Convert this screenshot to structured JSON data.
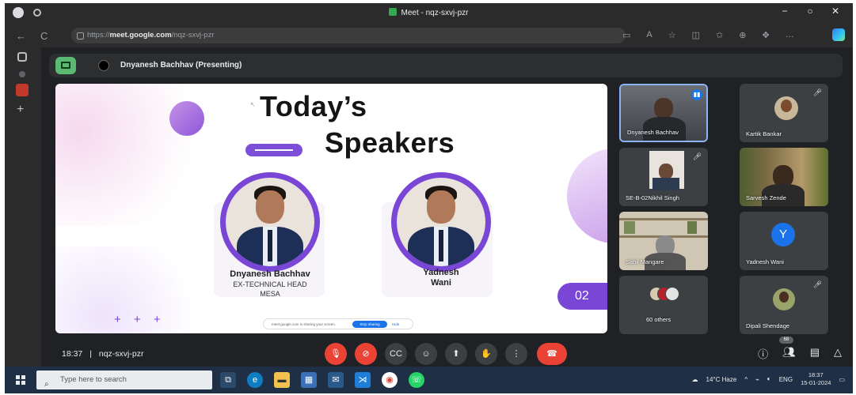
{
  "browser": {
    "tab_title": "Meet - nqz-sxvj-pzr",
    "url_prefix": "https://",
    "url_host": "meet.google.com",
    "url_path": "/nqz-sxvj-pzr",
    "back_icon": "←",
    "reload_icon": "C",
    "minimize": "−",
    "maximize": "○",
    "close": "✕"
  },
  "presenting": {
    "label": "Dnyanesh Bachhav (Presenting)"
  },
  "slide": {
    "title_line1": "Today’s",
    "title_line2": "Speakers",
    "speakers": [
      {
        "name": "Dnyanesh Bachhav",
        "role_line1": "EX-TECHNICAL HEAD",
        "role_line2": "MESA"
      },
      {
        "name_line1": "Yadnesh",
        "name_line2": "Wani"
      }
    ],
    "page_number": "02",
    "stars": "+ + +",
    "share_notice": "meet.google.com is sharing your screen.",
    "stop_sharing": "Stop sharing",
    "hide": "Hide"
  },
  "participants": [
    {
      "name": "Dnyanesh Bachhav",
      "speaking": true
    },
    {
      "name": "Kartik Bankar",
      "muted": true
    },
    {
      "name": "SE-B-02Nikhil Singh",
      "muted": true
    },
    {
      "name": "Sarvesh Zende"
    },
    {
      "name": "Sahil Mangare"
    },
    {
      "name": "Yadnesh Wani",
      "avatar_letter": "Y"
    },
    {
      "name": "60 others"
    },
    {
      "name": "Dipali Shendage",
      "muted": true
    }
  ],
  "meeting": {
    "time": "18:37",
    "separator": "|",
    "code": "nqz-sxvj-pzr",
    "participant_count": "68"
  },
  "controls": {
    "mic": "🎙",
    "camera": "⊘",
    "captions": "CC",
    "emoji": "☺",
    "present": "⬆",
    "raise_hand": "✋",
    "more": "⋮",
    "hangup": "☎"
  },
  "taskbar": {
    "search_placeholder": "Type here to search",
    "weather": "14°C Haze",
    "language": "ENG",
    "clock_time": "18:37",
    "clock_date": "15-01-2024"
  },
  "colors": {
    "accent_purple": "#7a46d6",
    "meet_dark": "#202124",
    "hangup_red": "#ea4335",
    "presenting_green": "#5bb974"
  }
}
